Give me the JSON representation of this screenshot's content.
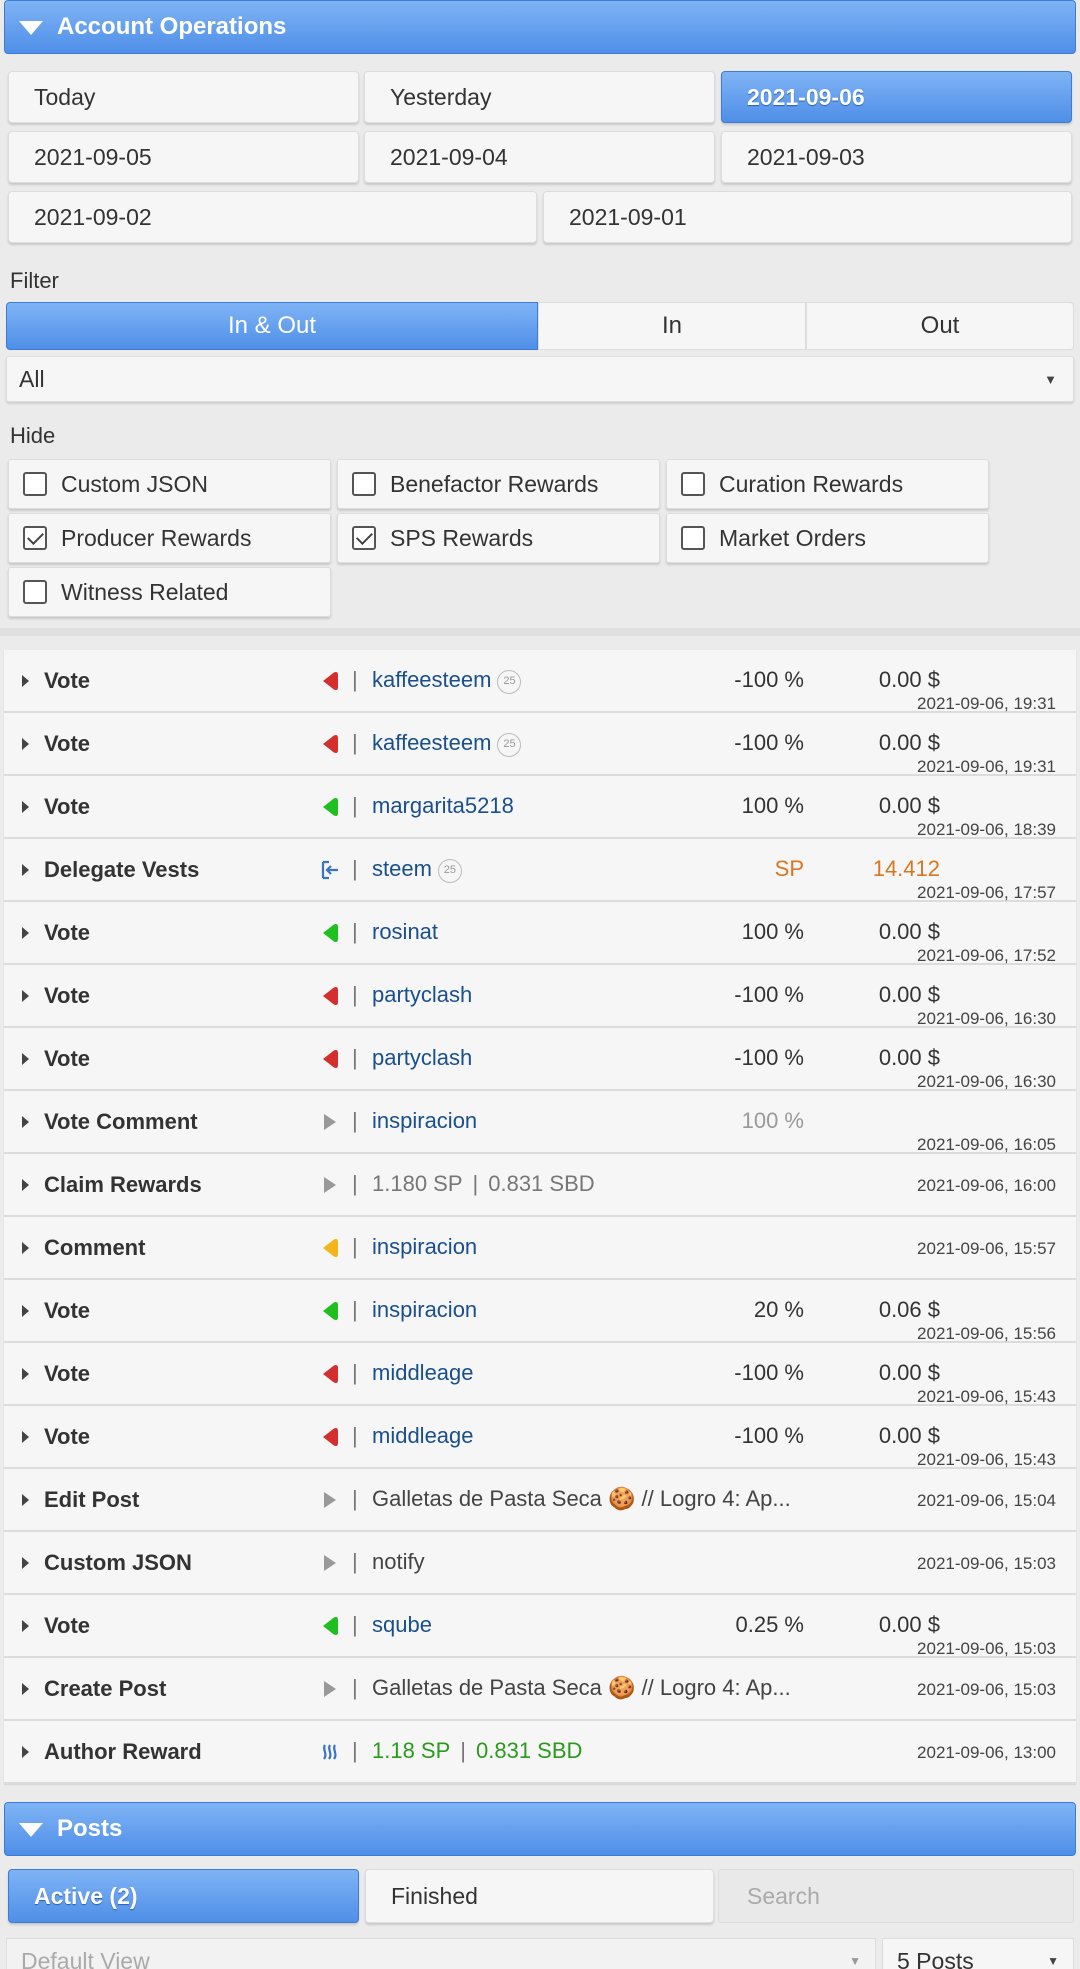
{
  "account_ops": {
    "title": "Account Operations",
    "date_buttons": [
      "Today",
      "Yesterday",
      "2021-09-06",
      "2021-09-05",
      "2021-09-04",
      "2021-09-03",
      "2021-09-02",
      "2021-09-01"
    ],
    "selected_date": "2021-09-06",
    "filter_label": "Filter",
    "filter_tabs": [
      "In & Out",
      "In",
      "Out"
    ],
    "selected_filter": "In & Out",
    "type_select": "All",
    "hide_label": "Hide",
    "hide_options": [
      {
        "label": "Custom JSON",
        "checked": false
      },
      {
        "label": "Benefactor Rewards",
        "checked": false
      },
      {
        "label": "Curation Rewards",
        "checked": false
      },
      {
        "label": "Producer Rewards",
        "checked": true
      },
      {
        "label": "SPS Rewards",
        "checked": true
      },
      {
        "label": "Market Orders",
        "checked": false
      },
      {
        "label": "Witness Related",
        "checked": false
      }
    ]
  },
  "operations": [
    {
      "type": "Vote",
      "icon": "downvote-red-icon",
      "color": "#d32f2f",
      "target": "kaffeesteem",
      "badge": "25",
      "pct": "-100 %",
      "amount": "0.00 $",
      "time": "2021-09-06, 19:31"
    },
    {
      "type": "Vote",
      "icon": "downvote-red-icon",
      "color": "#d32f2f",
      "target": "kaffeesteem",
      "badge": "25",
      "pct": "-100 %",
      "amount": "0.00 $",
      "time": "2021-09-06, 19:31"
    },
    {
      "type": "Vote",
      "icon": "upvote-green-icon",
      "color": "#1fbf1f",
      "target": "margarita5218",
      "pct": "100 %",
      "amount": "0.00 $",
      "time": "2021-09-06, 18:39"
    },
    {
      "type": "Delegate Vests",
      "icon": "delegate-icon",
      "color": "#3b74c4",
      "target": "steem",
      "badge": "25",
      "pct": "SP",
      "amount": "14.412",
      "time": "2021-09-06, 17:57"
    },
    {
      "type": "Vote",
      "icon": "upvote-green-icon",
      "color": "#1fbf1f",
      "target": "rosinat",
      "pct": "100 %",
      "amount": "0.00 $",
      "time": "2021-09-06, 17:52"
    },
    {
      "type": "Vote",
      "icon": "downvote-red-icon",
      "color": "#d32f2f",
      "target": "partyclash",
      "pct": "-100 %",
      "amount": "0.00 $",
      "time": "2021-09-06, 16:30"
    },
    {
      "type": "Vote",
      "icon": "downvote-red-icon",
      "color": "#d32f2f",
      "target": "partyclash",
      "pct": "-100 %",
      "amount": "0.00 $",
      "time": "2021-09-06, 16:30"
    },
    {
      "type": "Vote Comment",
      "icon": "play-grey-icon",
      "color": "#999999",
      "target": "inspiracion",
      "pct": "100 %",
      "time": "2021-09-06, 16:05"
    },
    {
      "type": "Claim Rewards",
      "icon": "play-grey-icon",
      "color": "#999999",
      "detail_sp": "1.180 SP",
      "detail_sbd": "0.831 SBD",
      "time": "2021-09-06, 16:00"
    },
    {
      "type": "Comment",
      "icon": "comment-yellow-icon",
      "color": "#f2b61a",
      "target": "inspiracion",
      "time": "2021-09-06, 15:57"
    },
    {
      "type": "Vote",
      "icon": "upvote-green-icon",
      "color": "#1fbf1f",
      "target": "inspiracion",
      "pct": "20 %",
      "amount": "0.06 $",
      "time": "2021-09-06, 15:56"
    },
    {
      "type": "Vote",
      "icon": "downvote-red-icon",
      "color": "#d32f2f",
      "target": "middleage",
      "pct": "-100 %",
      "amount": "0.00 $",
      "time": "2021-09-06, 15:43"
    },
    {
      "type": "Vote",
      "icon": "downvote-red-icon",
      "color": "#d32f2f",
      "target": "middleage",
      "pct": "-100 %",
      "amount": "0.00 $",
      "time": "2021-09-06, 15:43"
    },
    {
      "type": "Edit Post",
      "icon": "play-grey-icon",
      "color": "#999999",
      "text": "Galletas de Pasta Seca 🍪 // Logro 4: Ap...",
      "time": "2021-09-06, 15:04"
    },
    {
      "type": "Custom JSON",
      "icon": "play-grey-icon",
      "color": "#999999",
      "text": "notify",
      "time": "2021-09-06, 15:03"
    },
    {
      "type": "Vote",
      "icon": "upvote-green-icon",
      "color": "#1fbf1f",
      "target": "sqube",
      "pct": "0.25 %",
      "amount": "0.00 $",
      "time": "2021-09-06, 15:03"
    },
    {
      "type": "Create Post",
      "icon": "play-grey-icon",
      "color": "#999999",
      "text": "Galletas de Pasta Seca 🍪 // Logro 4: Ap...",
      "time": "2021-09-06, 15:03"
    },
    {
      "type": "Author Reward",
      "icon": "steem-logo-icon",
      "color": "#3b74c4",
      "detail_sp": "1.18 SP",
      "detail_sbd": "0.831 SBD",
      "time": "2021-09-06, 13:00"
    }
  ],
  "posts": {
    "title": "Posts",
    "tabs": [
      "Active (2)",
      "Finished"
    ],
    "selected_tab": "Active (2)",
    "search_placeholder": "Search",
    "view_select": "Default View",
    "count_select": "5 Posts"
  }
}
